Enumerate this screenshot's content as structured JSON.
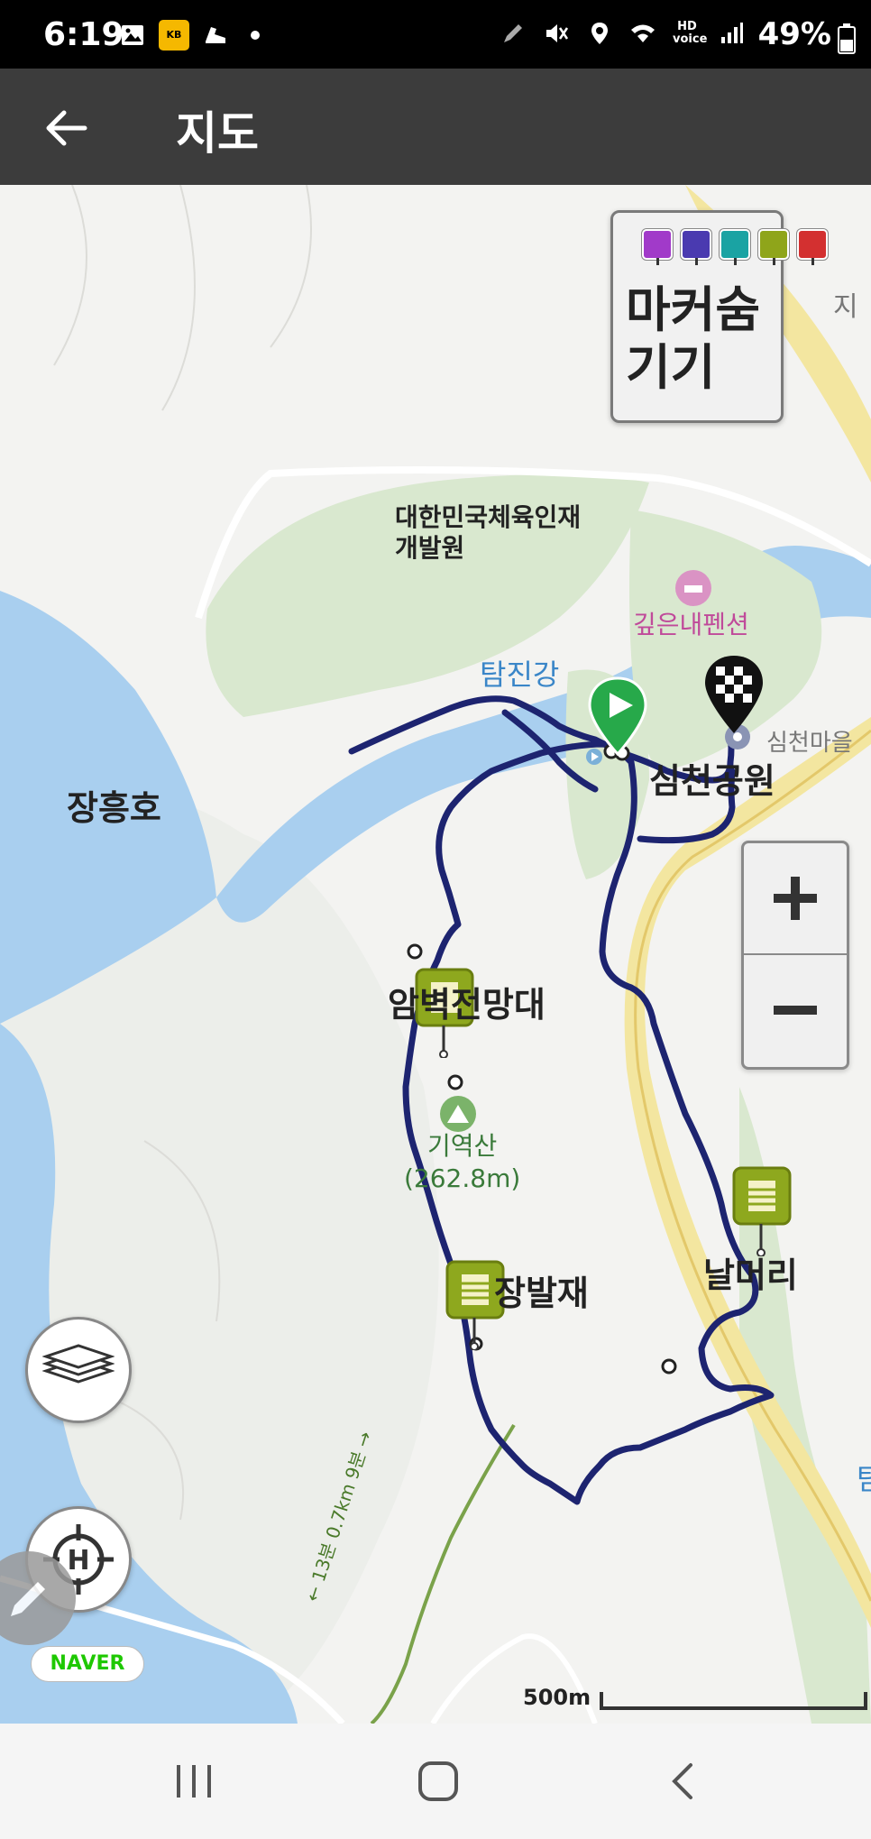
{
  "status_bar": {
    "time": "6:19",
    "battery": "49%",
    "kb_tag": "KB",
    "hd_label": "HD\nvoice"
  },
  "app_bar": {
    "title": "지도",
    "back_icon": "arrow-left-icon"
  },
  "map": {
    "labels": {
      "sports_center": "대한민국체육인재\n개발원",
      "river": "탐진강",
      "lake": "장흥호",
      "pension": "깊은내펜션",
      "park": "심천공원",
      "village": "심천마을",
      "top_right_partial": "지",
      "cliff_viewpoint": "암벽전망대",
      "peak_name": "기역산",
      "peak_elev": "(262.8m)",
      "pass_name": "장발재",
      "river_bend": "날머리",
      "trail_note": "← 13분 0.7km 9분 →",
      "right_edge": "탐"
    },
    "route_color": "#1d2470"
  },
  "marker_panel": {
    "label": "마커숨기기",
    "marker_icons": [
      {
        "name": "camera-marker-icon",
        "color": "#a13ac9"
      },
      {
        "name": "video-marker-icon",
        "color": "#4a3ab0"
      },
      {
        "name": "mic-marker-icon",
        "color": "#1aa3a3"
      },
      {
        "name": "note-marker-icon",
        "color": "#8fa51a"
      },
      {
        "name": "flag-marker-icon",
        "color": "#d33030"
      }
    ]
  },
  "zoom": {
    "in": "+",
    "out": "−"
  },
  "brand": "NAVER",
  "scale": "500m"
}
